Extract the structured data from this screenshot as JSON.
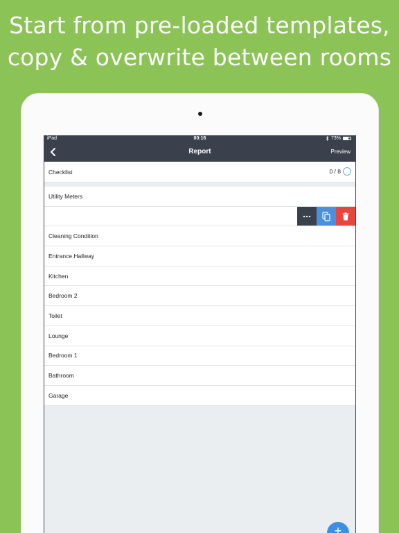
{
  "headline": {
    "line1": "Start from pre-loaded templates,",
    "line2": "copy & overwrite between rooms"
  },
  "status_bar": {
    "carrier": "iPad",
    "time": "00:16",
    "battery": "73%",
    "battery_level": 0.73,
    "icons": [
      "bluetooth-icon",
      "battery-icon"
    ]
  },
  "nav": {
    "back_icon": "chevron-left-icon",
    "title": "Report",
    "preview": "Preview"
  },
  "checklist": {
    "label": "Checklist",
    "progress": "0 / 8"
  },
  "rooms": [
    "Utility Meters",
    "",
    "Cleaning Condition",
    "Entrance Hallway",
    "Kitchen",
    "Bedroom 2",
    "Toilet",
    "Lounge",
    "Bedroom 1",
    "Bathroom",
    "Garage"
  ],
  "swipe_actions": [
    "more-icon",
    "copy-icon",
    "trash-icon"
  ],
  "colors": {
    "background": "#8bc356",
    "navbar": "#3a414c",
    "copy_action": "#4a8fe0",
    "delete_action": "#e8453c",
    "fab": "#3e8ee8"
  },
  "fab": {
    "label": "+"
  }
}
